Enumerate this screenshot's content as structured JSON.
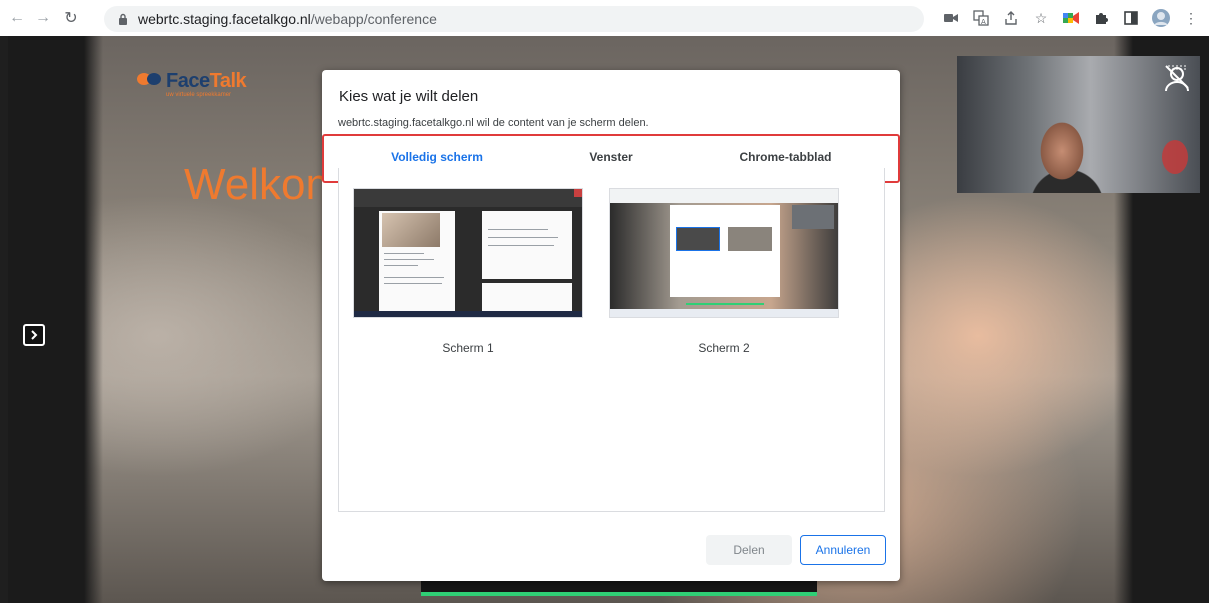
{
  "browser": {
    "url_host": "webrtc.staging.facetalkgo.nl",
    "url_path": "/webapp/conference",
    "icons": [
      "camera-icon",
      "translate-icon",
      "share-icon",
      "bookmark-star-icon",
      "extension-meet-icon",
      "extensions-puzzle-icon",
      "side-panel-icon",
      "profile-avatar-icon",
      "kebab-menu-icon"
    ]
  },
  "page": {
    "logo_face": "Face",
    "logo_talk": "Talk",
    "logo_tagline": "uw virtuele spreekkamer",
    "welcome_text": "Welkom b"
  },
  "dialog": {
    "title": "Kies wat je wilt delen",
    "subtitle": "webrtc.staging.facetalkgo.nl wil de content van je scherm delen.",
    "tabs": [
      {
        "label": "Volledig scherm",
        "active": true
      },
      {
        "label": "Venster",
        "active": false
      },
      {
        "label": "Chrome-tabblad",
        "active": false
      }
    ],
    "screens": [
      {
        "label": "Scherm 1"
      },
      {
        "label": "Scherm 2"
      }
    ],
    "share_label": "Delen",
    "cancel_label": "Annuleren"
  },
  "controls": {
    "items": [
      "speaker-icon",
      "camera-icon",
      "microphone-icon",
      "power-leave-icon",
      "screen-share-icon",
      "file-add-icon",
      "pin-icon",
      "add-person-icon"
    ],
    "accent_color": "#2fcf75",
    "leave_color": "#e53935"
  },
  "colors": {
    "brand_orange": "#ef7a2f",
    "brand_navy": "#1d3f6e",
    "chrome_blue": "#1a73e8",
    "highlight_red": "#e03b3b"
  }
}
